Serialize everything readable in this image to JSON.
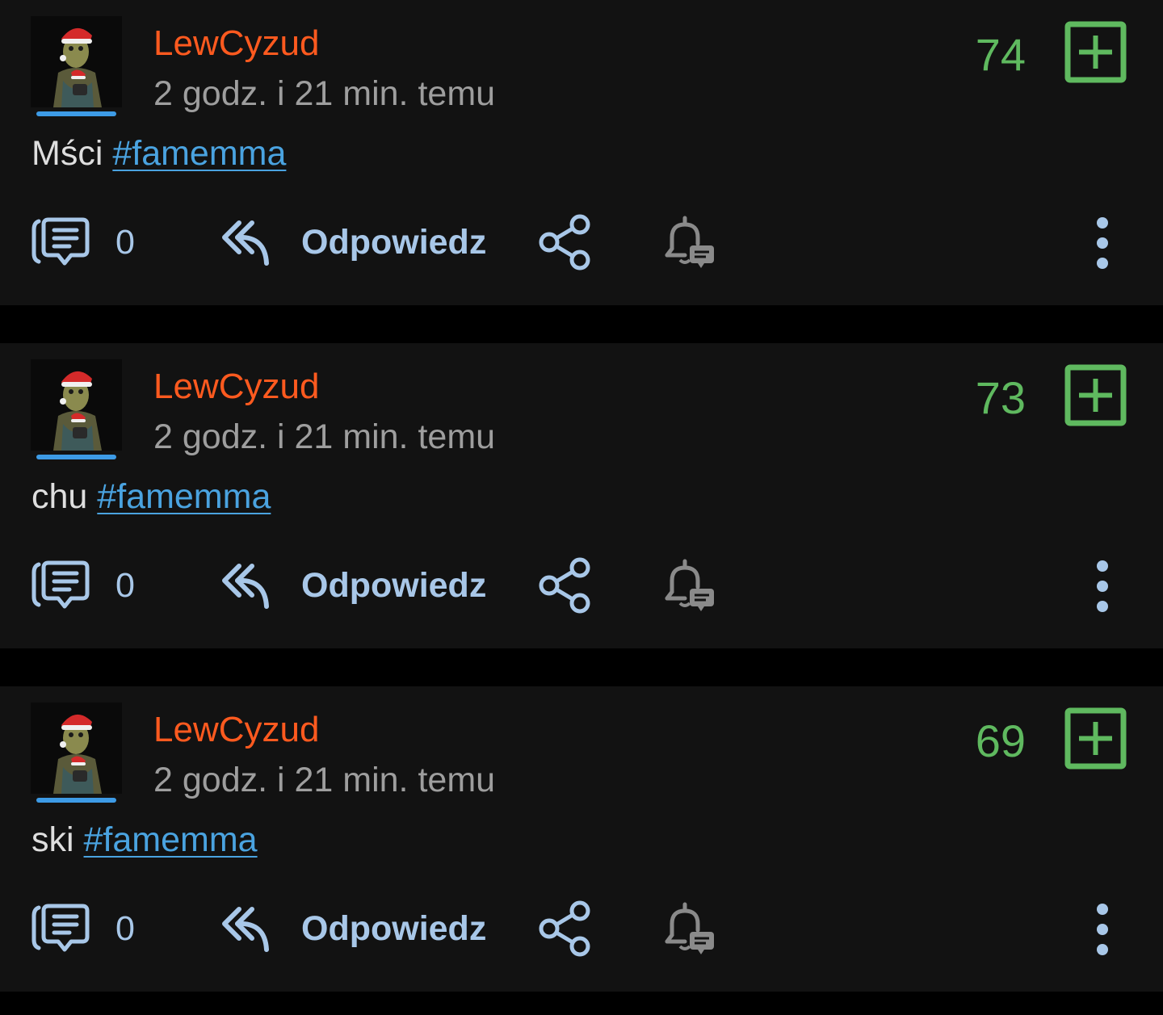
{
  "posts": [
    {
      "author": "LewCyzud",
      "time": "2 godz. i 21 min. temu",
      "score": "74",
      "text": "Mści",
      "tag": "#famemma",
      "comments": "0",
      "reply_label": "Odpowiedz"
    },
    {
      "author": "LewCyzud",
      "time": "2 godz. i 21 min. temu",
      "score": "73",
      "text": "chu",
      "tag": "#famemma",
      "comments": "0",
      "reply_label": "Odpowiedz"
    },
    {
      "author": "LewCyzud",
      "time": "2 godz. i 21 min. temu",
      "score": "69",
      "text": "ski",
      "tag": "#famemma",
      "comments": "0",
      "reply_label": "Odpowiedz"
    }
  ],
  "icons": {
    "comment": "comment-icon",
    "reply": "reply-icon",
    "share": "share-icon",
    "notify": "bell-notify-icon",
    "more": "more-vertical-icon",
    "vote": "plus-box-icon"
  },
  "colors": {
    "author": "#ff5a1f",
    "score": "#5fb95f",
    "tag": "#4aa3e0",
    "avatar_underline": "#3d9be6",
    "action": "#a8c7e8",
    "card": "#121212",
    "background": "#000000"
  }
}
